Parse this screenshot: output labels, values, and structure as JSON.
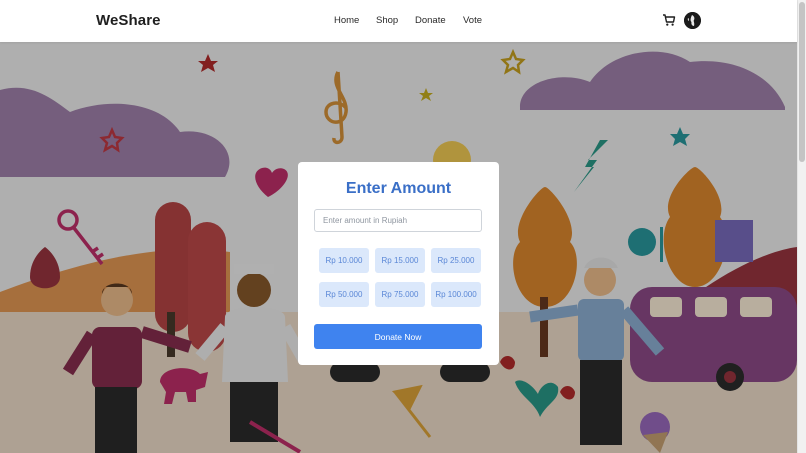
{
  "navbar": {
    "brand": "WeShare",
    "links": [
      "Home",
      "Shop",
      "Donate",
      "Vote"
    ],
    "cart_icon": "cart-icon",
    "avatar_icon": "globe-avatar-icon"
  },
  "modal": {
    "title": "Enter Amount",
    "input_placeholder": "Enter amount in Rupiah",
    "input_value": "",
    "amount_options": [
      "Rp 10.000",
      "Rp 15.000",
      "Rp 25.000",
      "Rp 50.000",
      "Rp 75.000",
      "Rp 100.000"
    ],
    "donate_button": "Donate Now"
  },
  "colors": {
    "accent": "#3f83ef",
    "title": "#3a6fc7",
    "chip_bg": "#dbe8fb",
    "chip_text": "#5a87d6"
  }
}
